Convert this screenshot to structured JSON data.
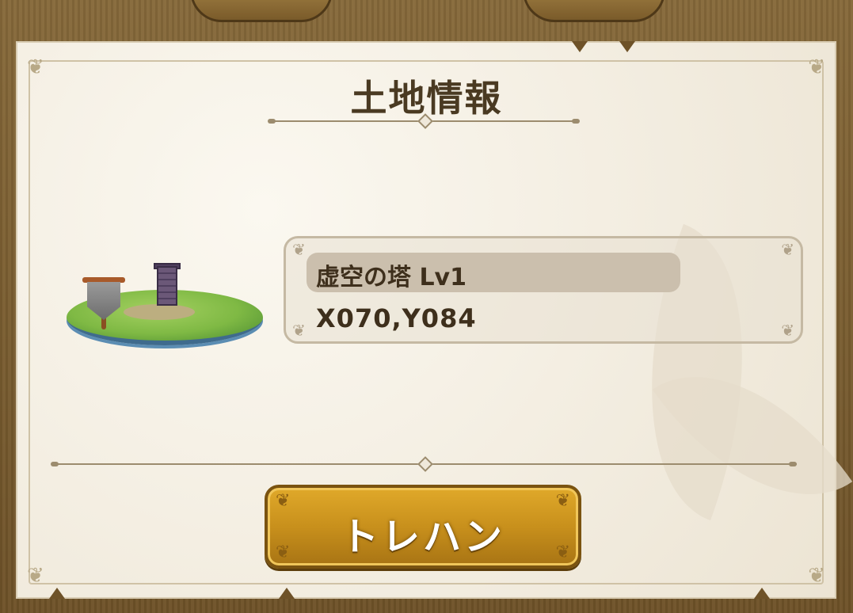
{
  "dialog": {
    "title": "土地情報"
  },
  "tile": {
    "name": "虚空の塔 Lv1",
    "coordinates": "X070,Y084"
  },
  "actions": {
    "treasure_hunt_label": "トレハン"
  },
  "colors": {
    "parchment": "#f2ecdf",
    "title_text": "#4a3a22",
    "button_gold": "#c8901c",
    "frame_wood": "#6e5228"
  },
  "icons": {
    "land": "land-tile-illustration",
    "tower": "tower-icon",
    "banner": "banner-flag-icon"
  }
}
